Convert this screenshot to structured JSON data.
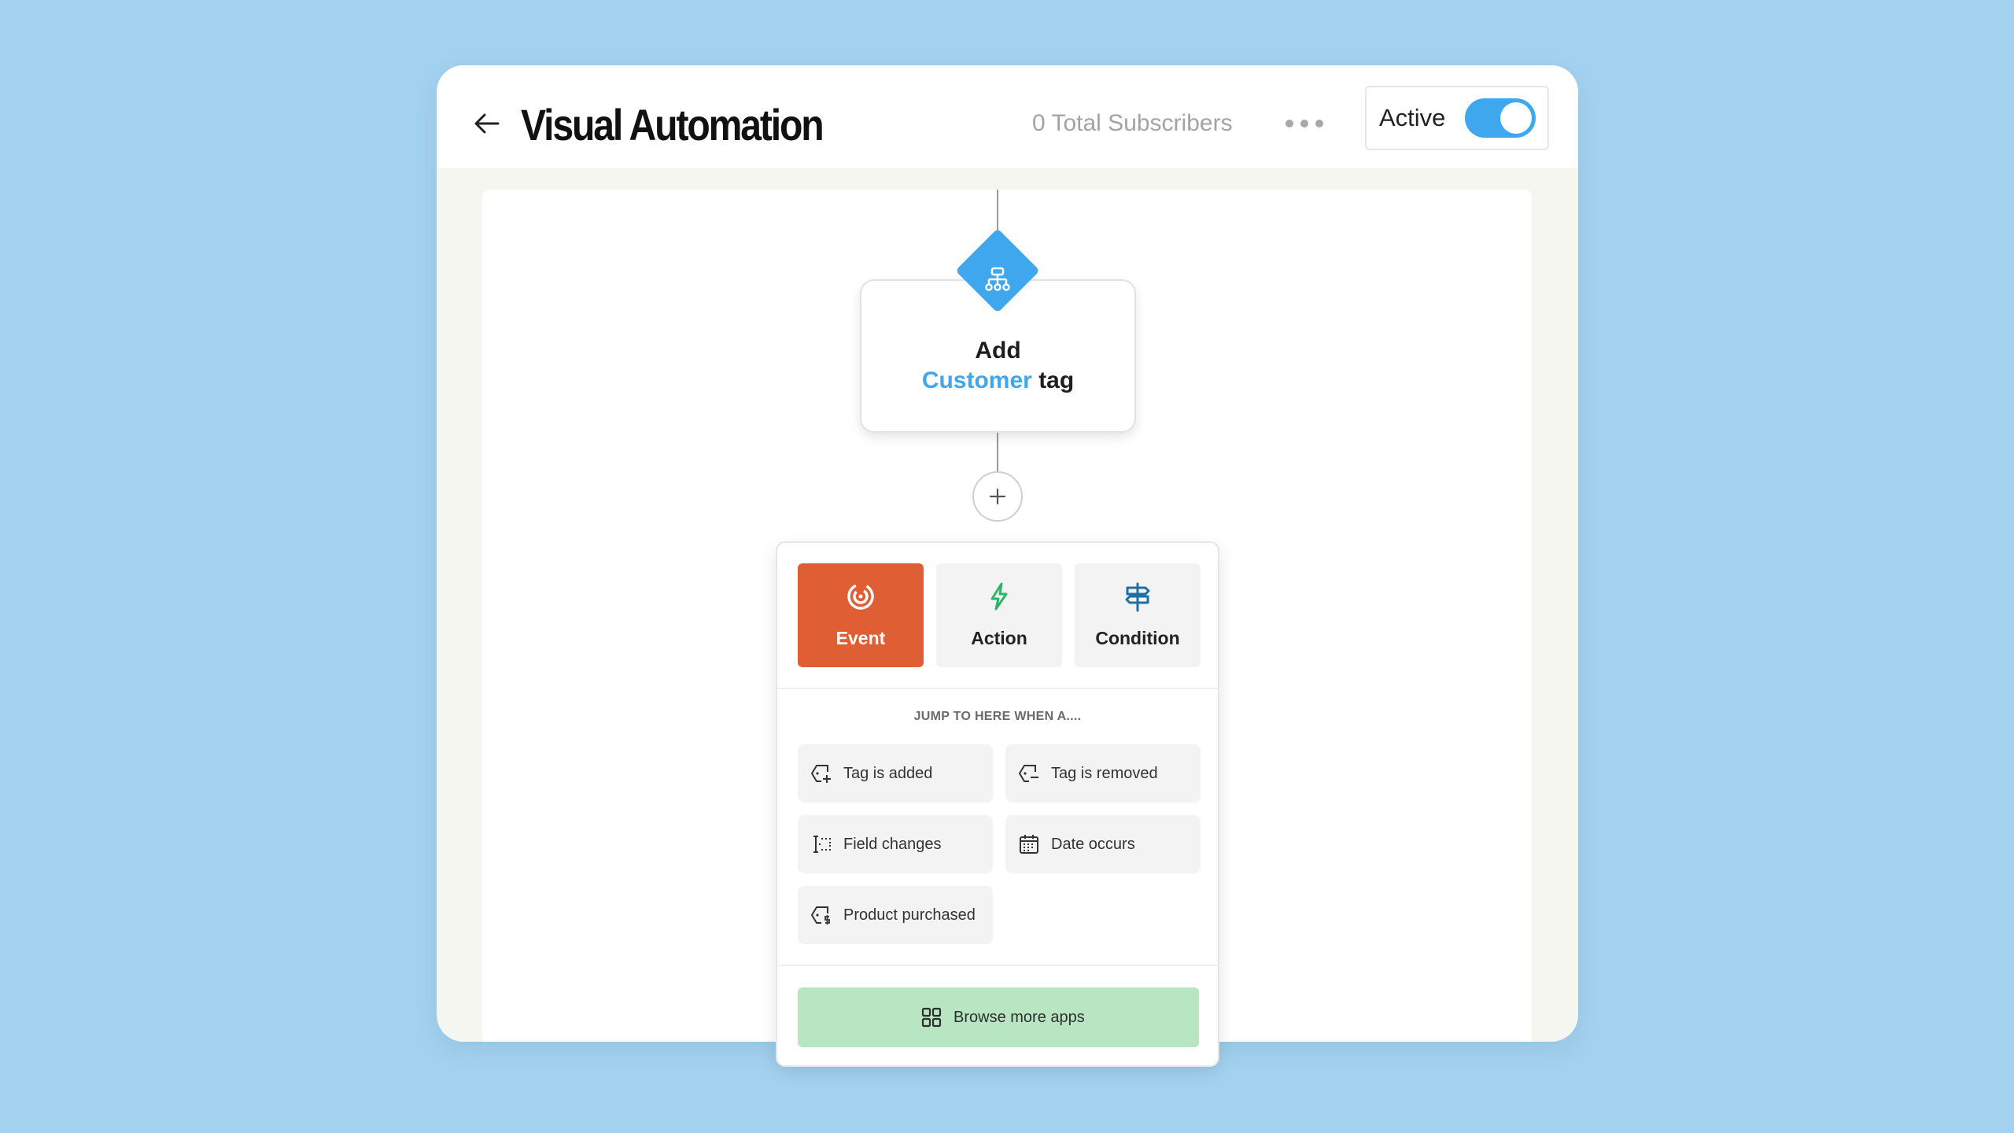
{
  "header": {
    "title": "Visual Automation",
    "subscribers": "0 Total Subscribers",
    "status_label": "Active",
    "toggle_on": true
  },
  "node": {
    "title": "Add",
    "tag_name": "Customer",
    "suffix": "tag",
    "icon": "sitemap-icon",
    "color": "#3ea7ed"
  },
  "picker": {
    "tabs": [
      {
        "label": "Event",
        "icon": "target-icon",
        "selected": true,
        "color": "#e05e34"
      },
      {
        "label": "Action",
        "icon": "lightning-icon",
        "selected": false,
        "color": "#2fb36a"
      },
      {
        "label": "Condition",
        "icon": "signpost-icon",
        "selected": false,
        "color": "#1d6fa8"
      }
    ],
    "jump_label": "JUMP TO HERE WHEN A....",
    "options": [
      {
        "label": "Tag is added",
        "icon": "tag-add-icon"
      },
      {
        "label": "Tag is removed",
        "icon": "tag-remove-icon"
      },
      {
        "label": "Field changes",
        "icon": "field-icon"
      },
      {
        "label": "Date occurs",
        "icon": "calendar-icon"
      },
      {
        "label": "Product purchased",
        "icon": "tag-dollar-icon"
      }
    ],
    "browse_label": "Browse more apps",
    "browse_color": "#b8e6c2"
  },
  "colors": {
    "background": "#a3d2f0",
    "accent": "#3ea7ed"
  }
}
